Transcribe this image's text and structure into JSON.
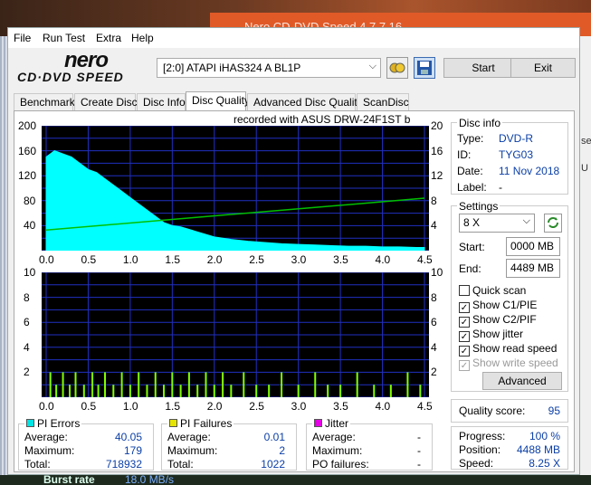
{
  "background": {
    "window_title_fragment": "Nero CD-DVD Speed 4.7.7.16",
    "right_fragments": [
      "se",
      "U"
    ],
    "bottom_label": "Burst rate",
    "bottom_value": "18.0 MB/s"
  },
  "menu": [
    "File",
    "Run Test",
    "Extra",
    "Help"
  ],
  "toolbar": {
    "logo_top": "nero",
    "logo_bottom": "CD·DVD SPEED",
    "drive": "[2:0]   ATAPI iHAS324   A BL1P",
    "start_label": "Start",
    "exit_label": "Exit"
  },
  "tabs": [
    {
      "label": "Benchmark",
      "active": false
    },
    {
      "label": "Create Disc",
      "active": false
    },
    {
      "label": "Disc Info",
      "active": false
    },
    {
      "label": "Disc Quality",
      "active": true
    },
    {
      "label": "Advanced Disc Quality",
      "active": false
    },
    {
      "label": "ScanDisc",
      "active": false
    }
  ],
  "recorded_with": "recorded with ASUS    DRW-24F1ST   b",
  "disc_info": {
    "title": "Disc info",
    "type_label": "Type:",
    "type": "DVD-R",
    "id_label": "ID:",
    "id": "TYG03",
    "date_label": "Date:",
    "date": "11 Nov 2018",
    "label_label": "Label:",
    "label": "-"
  },
  "settings": {
    "title": "Settings",
    "speed": "8 X",
    "start_label": "Start:",
    "start": "0000 MB",
    "end_label": "End:",
    "end": "4489 MB",
    "checkboxes": [
      {
        "label": "Quick scan",
        "checked": false,
        "disabled": false
      },
      {
        "label": "Show C1/PIE",
        "checked": true,
        "disabled": false
      },
      {
        "label": "Show C2/PIF",
        "checked": true,
        "disabled": false
      },
      {
        "label": "Show jitter",
        "checked": true,
        "disabled": false
      },
      {
        "label": "Show read speed",
        "checked": true,
        "disabled": false
      },
      {
        "label": "Show write speed",
        "checked": true,
        "disabled": true
      }
    ],
    "advanced_label": "Advanced"
  },
  "quality": {
    "label": "Quality score:",
    "value": "95"
  },
  "progress": {
    "progress_label": "Progress:",
    "progress": "100 %",
    "position_label": "Position:",
    "position": "4488 MB",
    "speed_label": "Speed:",
    "speed": "8.25 X"
  },
  "stats": {
    "pi_errors": {
      "title": "PI Errors",
      "color": "#00e5e5",
      "average_label": "Average:",
      "average": "40.05",
      "maximum_label": "Maximum:",
      "maximum": "179",
      "total_label": "Total:",
      "total": "718932"
    },
    "pi_failures": {
      "title": "PI Failures",
      "color": "#e5e500",
      "average_label": "Average:",
      "average": "0.01",
      "maximum_label": "Maximum:",
      "maximum": "2",
      "total_label": "Total:",
      "total": "1022"
    },
    "jitter": {
      "title": "Jitter",
      "color": "#e500e5",
      "average_label": "Average:",
      "average": "-",
      "maximum_label": "Maximum:",
      "maximum": "-",
      "po_label": "PO failures:",
      "po": "-"
    }
  },
  "chart_data": [
    {
      "type": "area",
      "title": "recorded with ASUS    DRW-24F1ST   b",
      "xlabel": "",
      "ylabel": "",
      "xlim": [
        0,
        4.5
      ],
      "ylim": [
        0,
        200
      ],
      "y2lim": [
        0,
        20
      ],
      "x_ticks": [
        "0.0",
        "0.5",
        "1.0",
        "1.5",
        "2.0",
        "2.5",
        "3.0",
        "3.5",
        "4.0",
        "4.5"
      ],
      "y_ticks": [
        "200",
        "160",
        "120",
        "80",
        "40"
      ],
      "y2_ticks": [
        "20",
        "16",
        "12",
        "8",
        "4"
      ],
      "grid": true,
      "series": [
        {
          "kind": "pie_envelope",
          "color": "#00ffff",
          "x": [
            0.0,
            0.1,
            0.2,
            0.3,
            0.4,
            0.5,
            0.6,
            0.7,
            0.8,
            0.9,
            1.0,
            1.1,
            1.2,
            1.3,
            1.4,
            1.5,
            1.6,
            1.7,
            1.8,
            1.9,
            2.0,
            2.2,
            2.4,
            2.6,
            2.8,
            3.0,
            3.2,
            3.4,
            3.6,
            3.8,
            4.0,
            4.2,
            4.4,
            4.5
          ],
          "values": [
            150,
            160,
            155,
            150,
            140,
            130,
            125,
            115,
            105,
            95,
            85,
            75,
            65,
            55,
            45,
            40,
            38,
            34,
            30,
            26,
            22,
            18,
            15,
            13,
            11,
            10,
            9,
            8,
            7,
            7,
            6,
            6,
            5,
            5
          ]
        },
        {
          "kind": "read_speed",
          "color": "#00c000",
          "axis": "right",
          "x": [
            0.0,
            4.5
          ],
          "values": [
            3.3,
            8.4
          ]
        }
      ]
    },
    {
      "type": "bar",
      "xlim": [
        0,
        4.5
      ],
      "ylim": [
        0,
        10
      ],
      "x_ticks": [
        "0.0",
        "0.5",
        "1.0",
        "1.5",
        "2.0",
        "2.5",
        "3.0",
        "3.5",
        "4.0",
        "4.5"
      ],
      "y_ticks": [
        "10",
        "8",
        "6",
        "4",
        "2"
      ],
      "y2_ticks": [
        "10",
        "8",
        "6",
        "4",
        "2"
      ],
      "grid": true,
      "series": [
        {
          "kind": "pif",
          "color": "#80ff00",
          "x": [
            0.05,
            0.12,
            0.2,
            0.28,
            0.35,
            0.45,
            0.55,
            0.62,
            0.7,
            0.8,
            0.9,
            1.0,
            1.1,
            1.2,
            1.3,
            1.4,
            1.5,
            1.6,
            1.7,
            1.8,
            1.9,
            2.0,
            2.1,
            2.2,
            2.35,
            2.5,
            2.65,
            2.8,
            3.0,
            3.2,
            3.35,
            3.5,
            3.7,
            3.9,
            4.1,
            4.3,
            4.45
          ],
          "values": [
            2,
            1,
            2,
            1,
            2,
            1,
            2,
            1,
            2,
            1,
            2,
            1,
            2,
            1,
            2,
            1,
            2,
            1,
            2,
            1,
            2,
            1,
            2,
            1,
            2,
            1,
            1,
            2,
            1,
            2,
            1,
            1,
            2,
            1,
            1,
            2,
            1
          ]
        }
      ]
    }
  ]
}
